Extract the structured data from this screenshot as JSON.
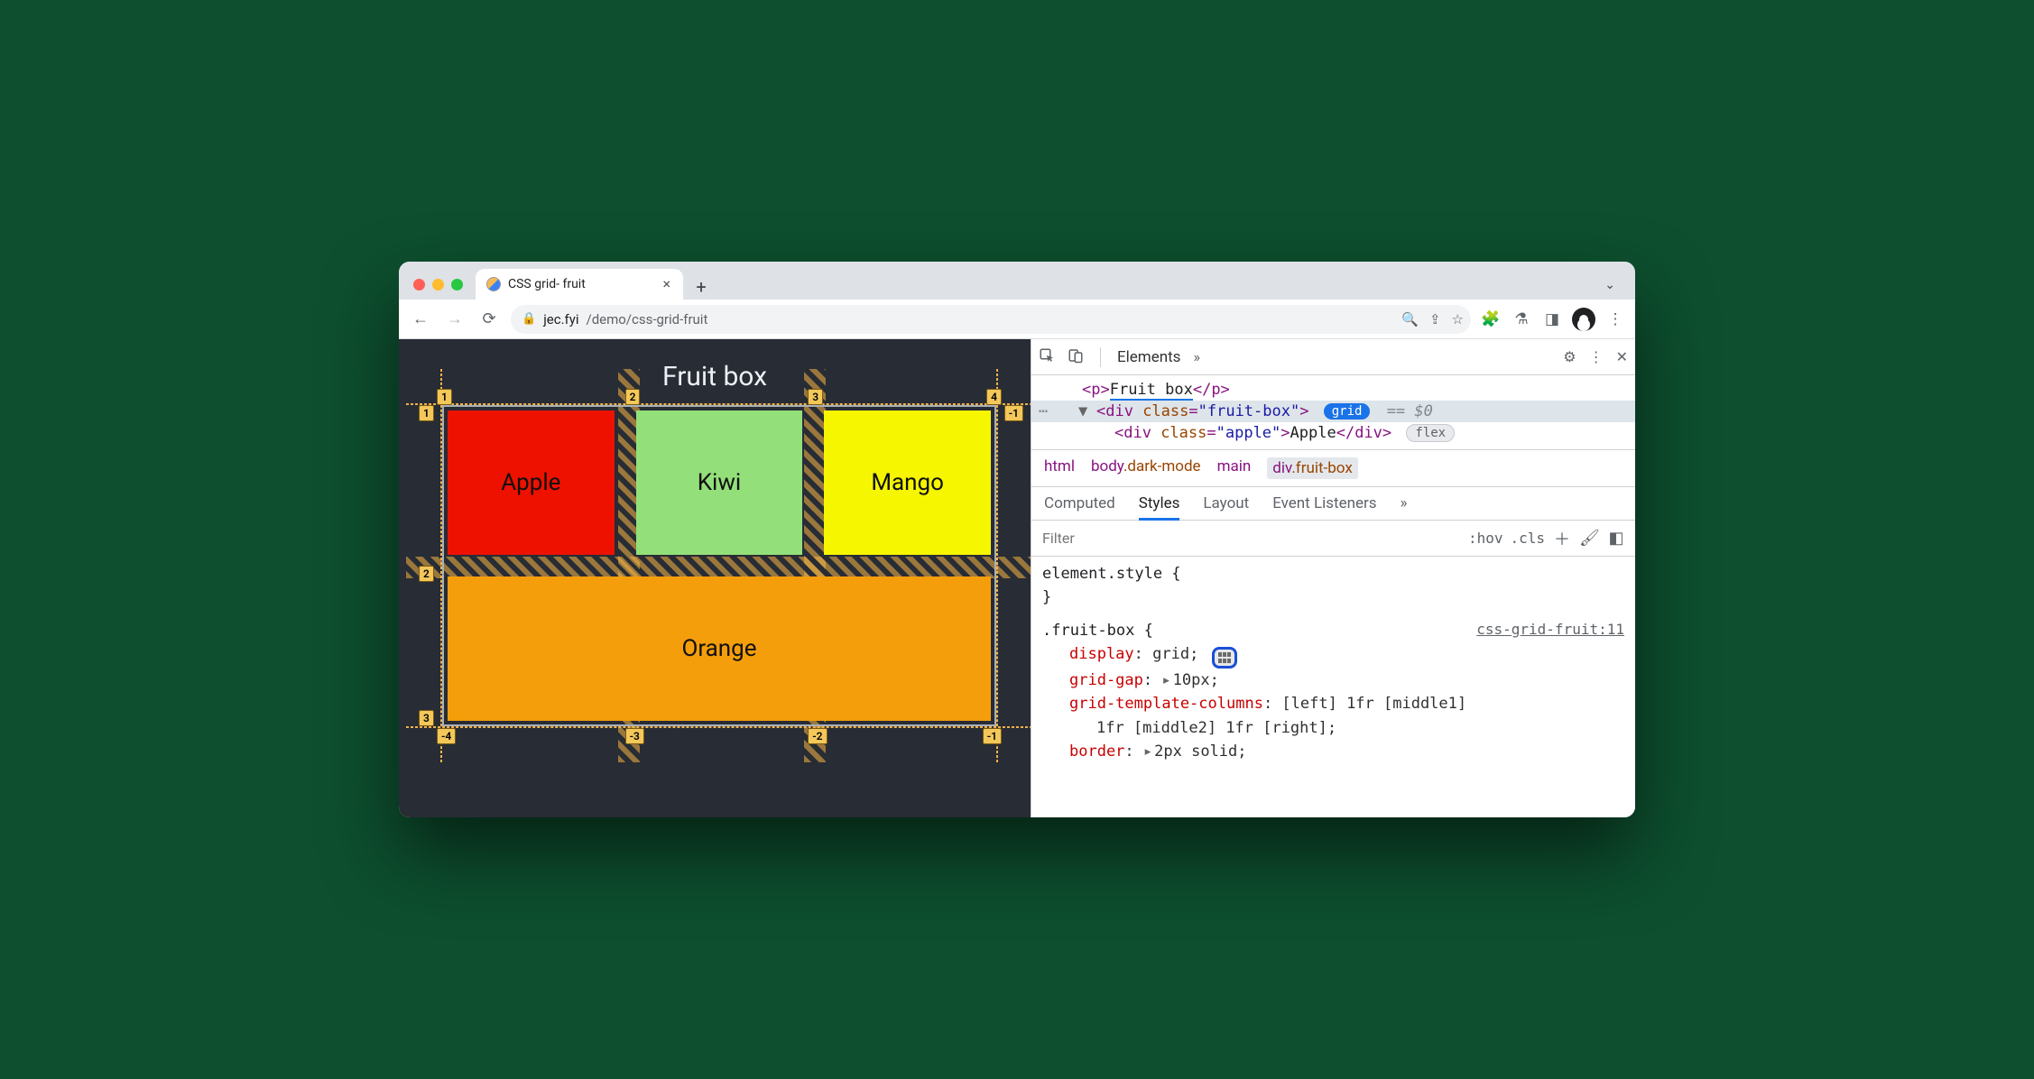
{
  "browser": {
    "tab_title": "CSS grid- fruit",
    "url_host": "jec.fyi",
    "url_path": "/demo/css-grid-fruit"
  },
  "page": {
    "heading": "Fruit box",
    "cells": {
      "apple": "Apple",
      "kiwi": "Kiwi",
      "mango": "Mango",
      "orange": "Orange"
    },
    "overlay": {
      "top": [
        "1",
        "2",
        "3",
        "4"
      ],
      "left": [
        "1",
        "2",
        "3"
      ],
      "right": [
        "-1"
      ],
      "bottom": [
        "-4",
        "-3",
        "-2",
        "-1"
      ]
    }
  },
  "devtools": {
    "panel": "Elements",
    "dom": {
      "line1": {
        "open": "<p>",
        "text": "Fruit box",
        "close": "</p>"
      },
      "line2": {
        "open": "<div ",
        "attr": "class",
        "val": "\"fruit-box\"",
        "close": ">",
        "badge": "grid",
        "dollar": "== $0"
      },
      "line3": {
        "open": "<div ",
        "attr": "class",
        "val": "\"apple\"",
        "mid": ">",
        "text": "Apple",
        "close": "</div>",
        "badge": "flex"
      }
    },
    "crumbs": [
      "html",
      "body",
      ".dark-mode",
      "main",
      "div",
      ".fruit-box"
    ],
    "subtabs": [
      "Computed",
      "Styles",
      "Layout",
      "Event Listeners"
    ],
    "filter_placeholder": "Filter",
    "filter_chips": [
      ":hov",
      ".cls"
    ],
    "styles": {
      "inline": "element.style {",
      "brace_close": "}",
      "rule_selector": ".fruit-box {",
      "rule_source": "css-grid-fruit:11",
      "props": {
        "display": {
          "name": "display",
          "value": "grid;"
        },
        "gap": {
          "name": "grid-gap",
          "value": "10px;"
        },
        "cols": {
          "name": "grid-template-columns",
          "value": "[left] 1fr [middle1]"
        },
        "cols2": "1fr [middle2] 1fr [right];",
        "border": {
          "name": "border",
          "value": "2px solid;"
        }
      }
    }
  }
}
